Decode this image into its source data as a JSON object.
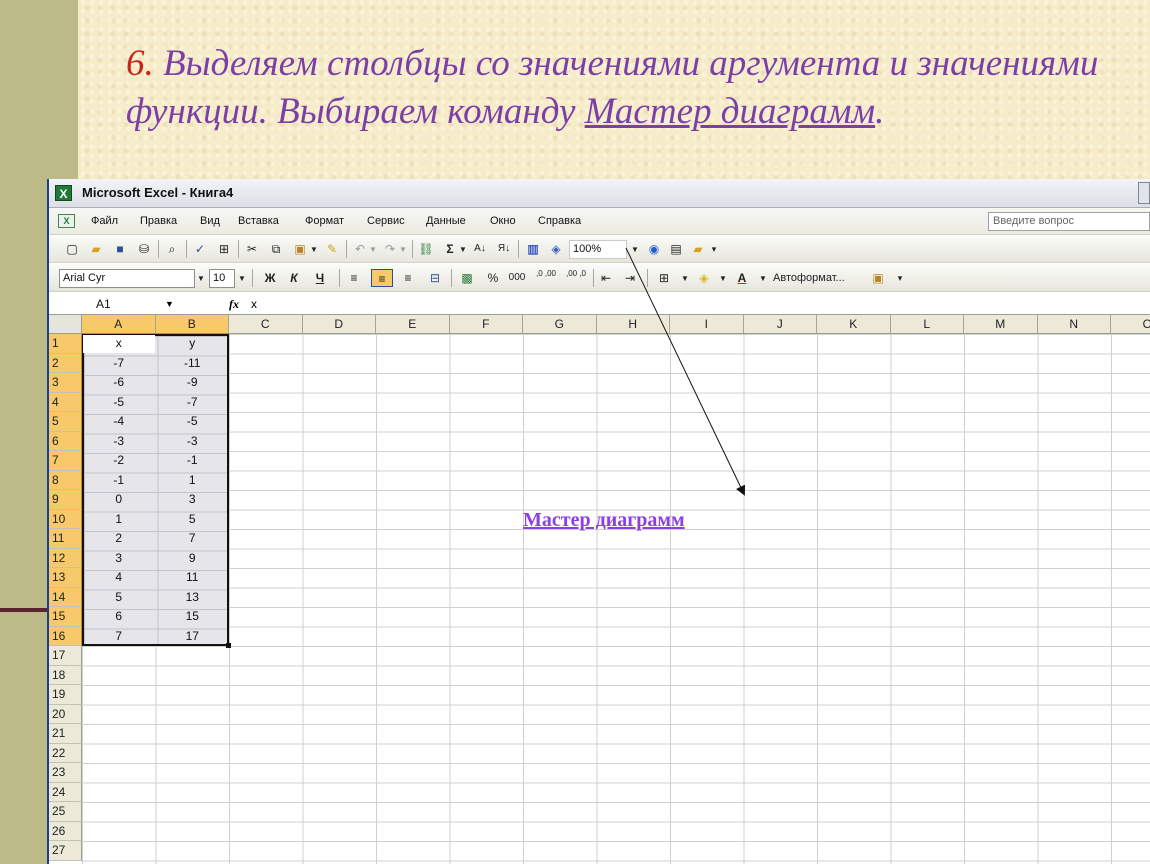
{
  "slide": {
    "step_number": "6.",
    "heading_part1": "Выделяем столбцы со значениями аргумента и значениями функции. Выбираем команду ",
    "heading_link": "Мастер диаграмм",
    "heading_end": ".",
    "caption": "Мастер диаграмм",
    "colors": {
      "heading": "#7b3fa8",
      "number": "#c8261a",
      "caption": "#8e3ee6",
      "sidebar": "#bdba8a"
    }
  },
  "window": {
    "title": "Microsoft Excel - Книга4",
    "app_icon": "excel-icon"
  },
  "menu": {
    "items": [
      "Файл",
      "Правка",
      "Вид",
      "Вставка",
      "Формат",
      "Сервис",
      "Данные",
      "Окно",
      "Справка"
    ],
    "ask_placeholder": "Введите вопрос"
  },
  "toolbar_standard": {
    "zoom": "100%"
  },
  "toolbar_format": {
    "font_name": "Arial Cyr",
    "font_size": "10",
    "bold": "Ж",
    "italic": "К",
    "underline": "Ч",
    "percent": "%",
    "thousands": "000",
    "inc_decimal": ",0 ,00",
    "dec_decimal": ",00 ,0",
    "autoformat": "Автоформат..."
  },
  "formula_bar": {
    "cell_ref": "A1",
    "fx": "fx",
    "value": "x"
  },
  "sheet": {
    "columns": [
      "A",
      "B",
      "C",
      "D",
      "E",
      "F",
      "G",
      "H",
      "I",
      "J",
      "K",
      "L",
      "M",
      "N",
      "O"
    ],
    "rows": [
      "1",
      "2",
      "3",
      "4",
      "5",
      "6",
      "7",
      "8",
      "9",
      "10",
      "11",
      "12",
      "13",
      "14",
      "15",
      "16",
      "17",
      "18",
      "19",
      "20",
      "21",
      "22",
      "23",
      "24",
      "25",
      "26",
      "27"
    ],
    "data": [
      [
        "x",
        "y"
      ],
      [
        "-7",
        "-11"
      ],
      [
        "-6",
        "-9"
      ],
      [
        "-5",
        "-7"
      ],
      [
        "-4",
        "-5"
      ],
      [
        "-3",
        "-3"
      ],
      [
        "-2",
        "-1"
      ],
      [
        "-1",
        "1"
      ],
      [
        "0",
        "3"
      ],
      [
        "1",
        "5"
      ],
      [
        "2",
        "7"
      ],
      [
        "3",
        "9"
      ],
      [
        "4",
        "11"
      ],
      [
        "5",
        "13"
      ],
      [
        "6",
        "15"
      ],
      [
        "7",
        "17"
      ]
    ],
    "selection_color": "#f8c96b"
  }
}
